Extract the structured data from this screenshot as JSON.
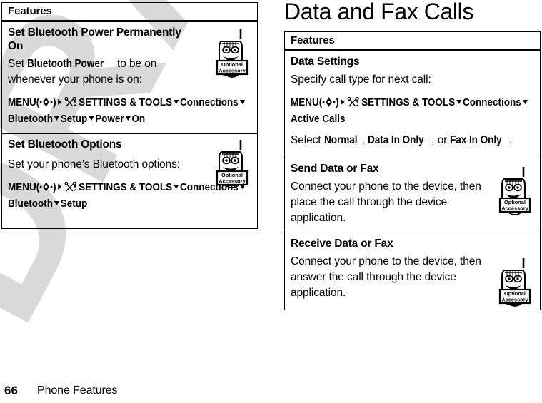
{
  "page": {
    "number": "66",
    "footer_title": "Phone Features",
    "watermark": "DRAFT",
    "heading": "Data and Fax Calls"
  },
  "icons": {
    "accessory_line1": "Optional",
    "accessory_line2": "Accessory",
    "accessory_name": "optional-accessory-icon",
    "tools_name": "settings-and-tools-icon",
    "center_select_name": "center-select-key-icon",
    "arrow_right_name": "arrow-right-icon",
    "arrow_down_name": "arrow-down-icon"
  },
  "left_table": {
    "header": "Features",
    "rows": [
      {
        "title": "Set Bluetooth Power Permanently On",
        "body_pre": "Set ",
        "body_bold": "Bluetooth Power",
        "body_post": " to be on whenever your phone is on:",
        "nav": {
          "menu_label": "MENU",
          "arrow1": "▸",
          "settings": "SETTINGS & TOOLS",
          "steps": [
            "Connections",
            "Bluetooth",
            "Setup",
            "Power",
            "On"
          ]
        },
        "has_accessory_icon": true
      },
      {
        "title": "Set Bluetooth Options",
        "body_pre": "Set your phone’s Bluetooth options:",
        "body_bold": "",
        "body_post": "",
        "nav": {
          "menu_label": "MENU",
          "arrow1": "▸",
          "settings": "SETTINGS & TOOLS",
          "steps": [
            "Connections",
            "Bluetooth",
            "Setup"
          ]
        },
        "has_accessory_icon": true
      }
    ]
  },
  "right_table": {
    "header": "Features",
    "rows": [
      {
        "title": "Data Settings",
        "body_pre": "Specify call type for next call:",
        "nav": {
          "menu_label": "MENU",
          "arrow1": "▸",
          "settings": "SETTINGS & TOOLS",
          "steps": [
            "Connections",
            "Active Calls"
          ]
        },
        "select_pre": "Select ",
        "select_opt1": "Normal",
        "select_sep1": ", ",
        "select_opt2": "Data In Only",
        "select_sep2": ", or ",
        "select_opt3": "Fax In Only",
        "select_post": ".",
        "has_accessory_icon": false
      },
      {
        "title": "Send Data or Fax",
        "body_pre": "Connect your phone to the device, then place the call through the device application.",
        "has_accessory_icon": true
      },
      {
        "title": "Receive Data or Fax",
        "body_pre": "Connect your phone to the device, then answer the call through the device application.",
        "has_accessory_icon": true
      }
    ]
  }
}
